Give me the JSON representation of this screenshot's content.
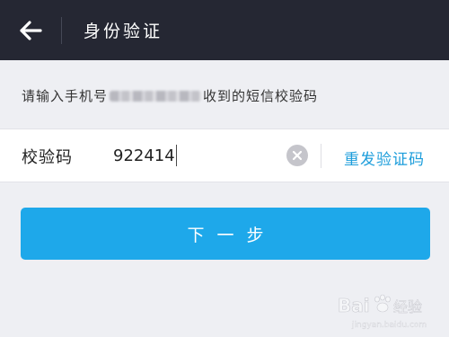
{
  "header": {
    "back_icon": "arrow-left-icon",
    "title": "身份验证"
  },
  "hint": {
    "prefix": "请输入手机号",
    "suffix": "收到的短信校验码"
  },
  "code_row": {
    "label": "校验码",
    "value": "922414",
    "clear_icon": "clear-x-icon",
    "resend_label": "重发验证码"
  },
  "actions": {
    "next_label": "下一步"
  },
  "watermark": {
    "brand": "Bai",
    "brand2": "经验",
    "url": "jingyan.baidu.com"
  },
  "colors": {
    "header_bg": "#252733",
    "page_bg": "#eeeff3",
    "accent": "#1ea8ea",
    "link": "#1c9ddb"
  }
}
